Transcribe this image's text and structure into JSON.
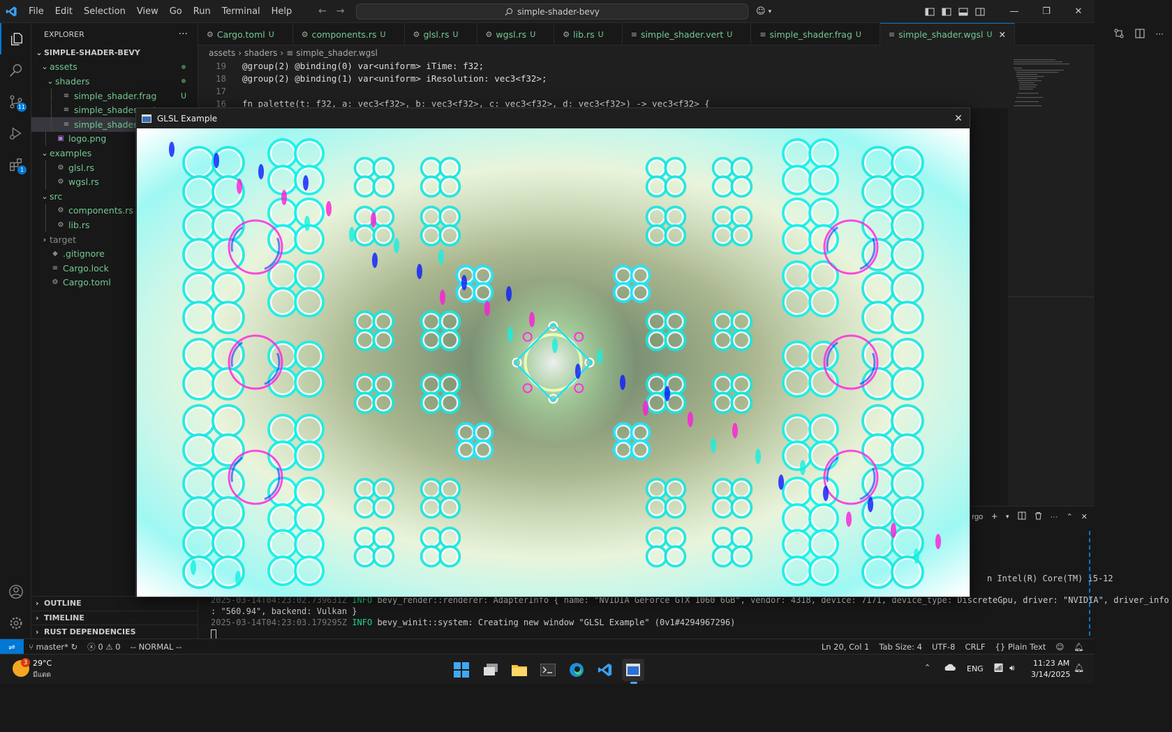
{
  "titlebar": {
    "menu": [
      "File",
      "Edit",
      "Selection",
      "View",
      "Go",
      "Run",
      "Terminal",
      "Help"
    ],
    "command_center": "simple-shader-bevy"
  },
  "activity_bar": {
    "source_control_badge": "11",
    "extensions_badge": "1"
  },
  "explorer": {
    "header": "EXPLORER",
    "more": "···",
    "root": "SIMPLE-SHADER-BEVY",
    "items": [
      {
        "label": "assets",
        "depth": 1,
        "type": "folder",
        "open": true,
        "git": "dot"
      },
      {
        "label": "shaders",
        "depth": 2,
        "type": "folder",
        "open": true,
        "git": "dot"
      },
      {
        "label": "simple_shader.frag",
        "depth": 3,
        "type": "file",
        "git": "U"
      },
      {
        "label": "simple_shader.vert",
        "depth": 3,
        "type": "file",
        "git": ""
      },
      {
        "label": "simple_shader.wgsl",
        "depth": 3,
        "type": "file",
        "git": "",
        "selected": true
      },
      {
        "label": "logo.png",
        "depth": 2,
        "type": "image",
        "git": ""
      },
      {
        "label": "examples",
        "depth": 1,
        "type": "folder",
        "open": true,
        "git": ""
      },
      {
        "label": "glsl.rs",
        "depth": 2,
        "type": "rust",
        "git": ""
      },
      {
        "label": "wgsl.rs",
        "depth": 2,
        "type": "rust",
        "git": ""
      },
      {
        "label": "src",
        "depth": 1,
        "type": "folder",
        "open": true,
        "git": ""
      },
      {
        "label": "components.rs",
        "depth": 2,
        "type": "rust",
        "git": ""
      },
      {
        "label": "lib.rs",
        "depth": 2,
        "type": "rust",
        "git": ""
      },
      {
        "label": "target",
        "depth": 1,
        "type": "folder",
        "open": false,
        "git": "",
        "dim": true
      },
      {
        "label": ".gitignore",
        "depth": 1,
        "type": "file",
        "git": ""
      },
      {
        "label": "Cargo.lock",
        "depth": 1,
        "type": "file",
        "git": ""
      },
      {
        "label": "Cargo.toml",
        "depth": 1,
        "type": "gear",
        "git": ""
      }
    ],
    "sections": [
      "OUTLINE",
      "TIMELINE",
      "RUST DEPENDENCIES"
    ]
  },
  "tabs": [
    {
      "label": "Cargo.toml",
      "status": "U"
    },
    {
      "label": "components.rs",
      "status": "U"
    },
    {
      "label": "glsl.rs",
      "status": "U"
    },
    {
      "label": "wgsl.rs",
      "status": "U"
    },
    {
      "label": "lib.rs",
      "status": "U"
    },
    {
      "label": "simple_shader.vert",
      "status": "U"
    },
    {
      "label": "simple_shader.frag",
      "status": "U"
    },
    {
      "label": "simple_shader.wgsl",
      "status": "U",
      "active": true
    }
  ],
  "breadcrumb": [
    "assets",
    "shaders",
    "simple_shader.wgsl"
  ],
  "editor": {
    "lines": [
      {
        "num": "19",
        "text": "@group(2) @binding(0) var<uniform> iTime: f32;"
      },
      {
        "num": "18",
        "text": "@group(2) @binding(1) var<uniform> iResolution: vec3<f32>;"
      },
      {
        "num": "17",
        "text": ""
      },
      {
        "num": "16",
        "text": "fn palette(t: f32, a: vec3<f32>, b: vec3<f32>, c: vec3<f32>, d: vec3<f32>) -> vec3<f32> {"
      }
    ]
  },
  "terminal": {
    "tab_label": "rgo",
    "partial_line": "n Intel(R) Core(TM) i5-12",
    "line1_ts": "2025-03-14T04:23:02.739631Z",
    "line1_level": "INFO",
    "line1_msg": " bevy_render::renderer: AdapterInfo { name: \"NVIDIA GeForce GTX 1060 6GB\", vendor: 4318, device: 7171, device_type: DiscreteGpu, driver: \"NVIDIA\", driver_info",
    "line2": ": \"560.94\", backend: Vulkan }",
    "line3_ts": "2025-03-14T04:23:03.179295Z",
    "line3_level": "INFO",
    "line3_msg": " bevy_winit::system: Creating new window \"GLSL Example\" (0v1#4294967296)"
  },
  "statusbar": {
    "branch": "master*",
    "errors": "0",
    "warnings": "0",
    "mode": "-- NORMAL --",
    "position": "Ln 20, Col 1",
    "tab_size": "Tab Size: 4",
    "encoding": "UTF-8",
    "eol": "CRLF",
    "language": "Plain Text"
  },
  "glsl_window": {
    "title": "GLSL Example"
  },
  "taskbar": {
    "weather_badge": "3",
    "temp": "29°C",
    "condition": "มีแดด",
    "lang": "ENG",
    "time": "11:23 AM",
    "date": "3/14/2025"
  }
}
